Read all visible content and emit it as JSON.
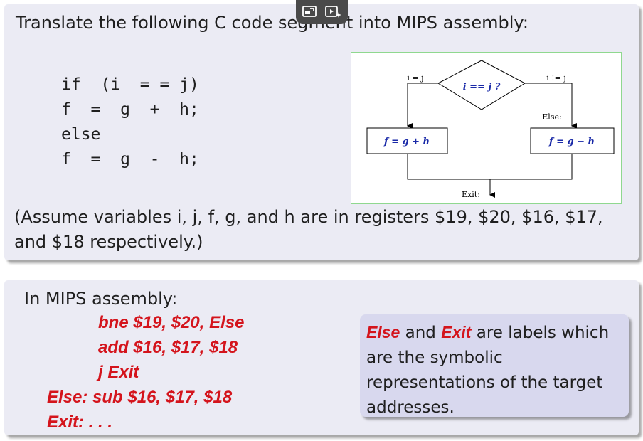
{
  "question": {
    "text": "Translate the following C code segment into MIPS assembly:",
    "code_lines": [
      "if  (i  = = j)",
      "f  =  g  +  h;",
      "else",
      "f  =  g  -  h;"
    ],
    "assume": "(Assume variables i, j, f, g, and h are in registers $19, $20, $16, $17, and $18 respectively.)"
  },
  "flowchart": {
    "condition": "i == j ?",
    "true_label": "i = j",
    "false_label": "i != j",
    "else_label": "Else:",
    "left_box": "f = g + h",
    "right_box": "f = g − h",
    "exit_label": "Exit:"
  },
  "answer": {
    "title": "In MIPS assembly:",
    "lines": [
      "bne $19, $20, Else",
      "add $16, $17, $18",
      "j Exit",
      "Else: sub $16, $17, $18",
      "Exit: . . ."
    ],
    "note_parts": [
      "Else",
      " and ",
      "Exit",
      " are labels which are the symbolic representations of the target addresses."
    ]
  },
  "overlay_icons": [
    "screen-share-icon",
    "video-sparkle-icon"
  ],
  "colors": {
    "accent_red": "#d4141c",
    "box_bg": "#ebebf4",
    "note_bg": "#d8d8ee",
    "flow_blue": "#1a2aa8"
  }
}
